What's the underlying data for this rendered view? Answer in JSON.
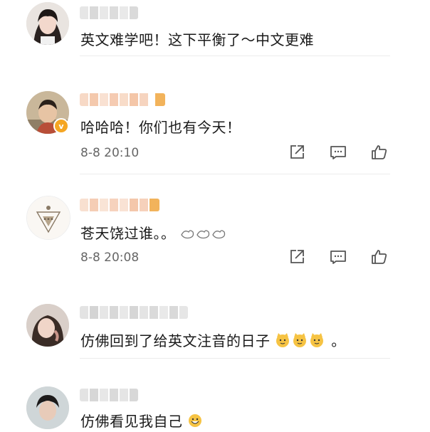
{
  "comments": [
    {
      "text": "英文难学吧！这下平衡了～中文更难"
    },
    {
      "text": "哈哈哈！你们也有今天！",
      "time": "8-8 20:10"
    },
    {
      "text": "苍天饶过谁。。",
      "time": "8-8 20:08"
    },
    {
      "text": "仿佛回到了给英文注音的日子",
      "text_end": "。"
    },
    {
      "text": "仿佛看见我自己"
    }
  ],
  "icons": {
    "share": "share-icon",
    "comment": "comment-icon",
    "like": "thumbs-up-icon",
    "verified": "verified-badge-icon"
  },
  "colors": {
    "verified": "#f5a623",
    "timestamp": "#666666",
    "divider": "#ececec"
  }
}
